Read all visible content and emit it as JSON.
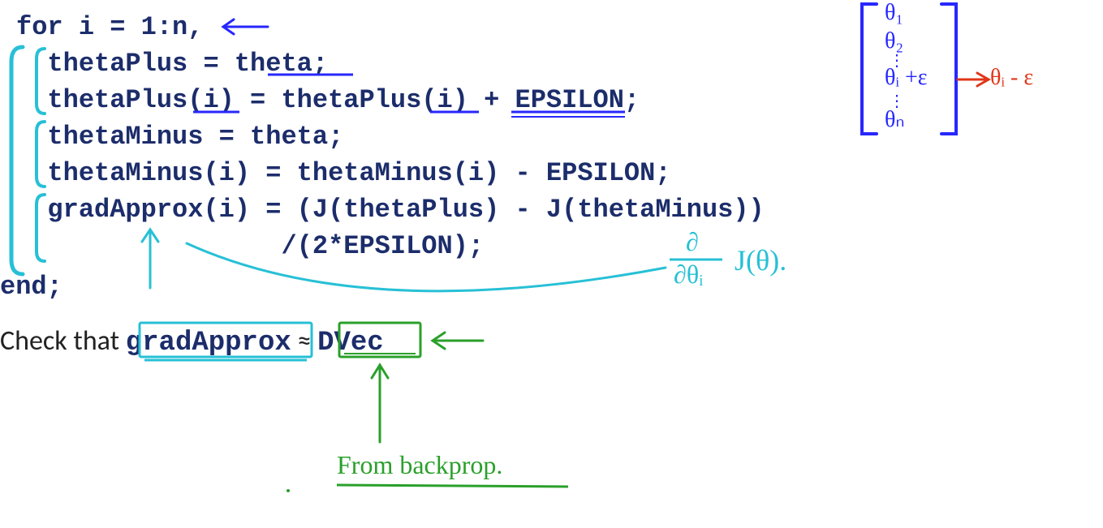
{
  "code": {
    "l1": "for i = 1:n,",
    "l2": "  thetaPlus = theta;",
    "l3": "  thetaPlus(i) = thetaPlus(i) + EPSILON;",
    "l4": "  thetaMinus = theta;",
    "l5": "  thetaMinus(i) = thetaMinus(i) - EPSILON;",
    "l6": "  gradApprox(i) = (J(thetaPlus) - J(thetaMinus))",
    "l7": "                 /(2*EPSILON);",
    "l8": "end;"
  },
  "check_line": {
    "prefix": "Check that ",
    "left": "gradApprox",
    "approx": " ≈ ",
    "right": "DVec"
  },
  "annotations": {
    "vector_theta1": "θ₁",
    "vector_theta2": "θ₂",
    "vector_dots": "⋮",
    "vector_thetai": "θᵢ +ε",
    "vector_thetai_minus": "θᵢ - ε",
    "vector_thetan": "θₙ",
    "partial": "∂",
    "partial_denom": "∂θᵢ",
    "j_of_theta": "J(θ).",
    "from_backprop": "From  backprop."
  },
  "colors": {
    "code": "#1c2d6b",
    "blue_ink": "#2727ff",
    "cyan_ink": "#27c0d6",
    "green_ink": "#2aa02a",
    "red_ink": "#e03618"
  }
}
